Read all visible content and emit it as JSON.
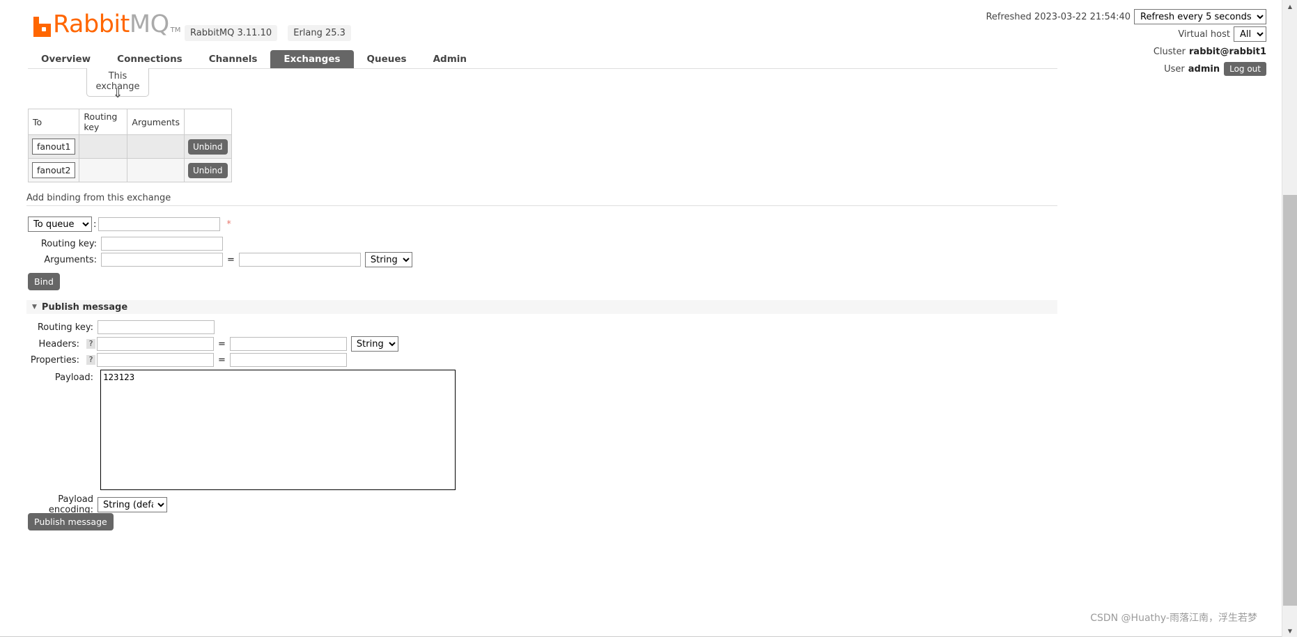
{
  "header": {
    "logo_rabbit": "Rabbit",
    "logo_mq": "MQ",
    "logo_tm": "TM",
    "version_rabbitmq": "RabbitMQ 3.11.10",
    "version_erlang": "Erlang 25.3",
    "refreshed_label": "Refreshed 2023-03-22 21:54:40",
    "refresh_select": "Refresh every 5 seconds",
    "vhost_label": "Virtual host",
    "vhost_select": "All",
    "cluster_label": "Cluster",
    "cluster_value": "rabbit@rabbit1",
    "user_label": "User",
    "user_value": "admin",
    "logout_label": "Log out"
  },
  "nav": {
    "items": [
      {
        "label": "Overview",
        "active": false
      },
      {
        "label": "Connections",
        "active": false
      },
      {
        "label": "Channels",
        "active": false
      },
      {
        "label": "Exchanges",
        "active": true
      },
      {
        "label": "Queues",
        "active": false
      },
      {
        "label": "Admin",
        "active": false
      }
    ]
  },
  "bindings": {
    "source_node_label": "This exchange",
    "arrow_glyph": "⇓",
    "columns": [
      "To",
      "Routing key",
      "Arguments",
      ""
    ],
    "rows": [
      {
        "to": "fanout1",
        "routing_key": "",
        "arguments": "",
        "action": "Unbind"
      },
      {
        "to": "fanout2",
        "routing_key": "",
        "arguments": "",
        "action": "Unbind"
      }
    ]
  },
  "add_binding": {
    "heading": "Add binding from this exchange",
    "destination_type": "To queue",
    "destination_value": "",
    "required_marker": "*",
    "colon": ":",
    "routing_key_label": "Routing key:",
    "routing_key_value": "",
    "arguments_label": "Arguments:",
    "arguments_key": "",
    "arguments_equals": "=",
    "arguments_value": "",
    "arguments_type": "String",
    "bind_label": "Bind"
  },
  "publish": {
    "section_title": "Publish message",
    "caret": "▼",
    "routing_key_label": "Routing key:",
    "routing_key_value": "",
    "headers_label": "Headers:",
    "headers_help": "?",
    "headers_key": "",
    "headers_equals": "=",
    "headers_value": "",
    "headers_type": "String",
    "properties_label": "Properties:",
    "properties_help": "?",
    "properties_key": "",
    "properties_equals": "=",
    "properties_value": "",
    "payload_label": "Payload:",
    "payload_value": "123123",
    "payload_encoding_label": "Payload encoding:",
    "payload_encoding_value": "String (default)",
    "publish_label": "Publish message"
  },
  "watermark": "CSDN @Huathy-雨落江南，浮生若梦",
  "scrollbar": {
    "up_glyph": "▲",
    "down_glyph": "▼"
  }
}
